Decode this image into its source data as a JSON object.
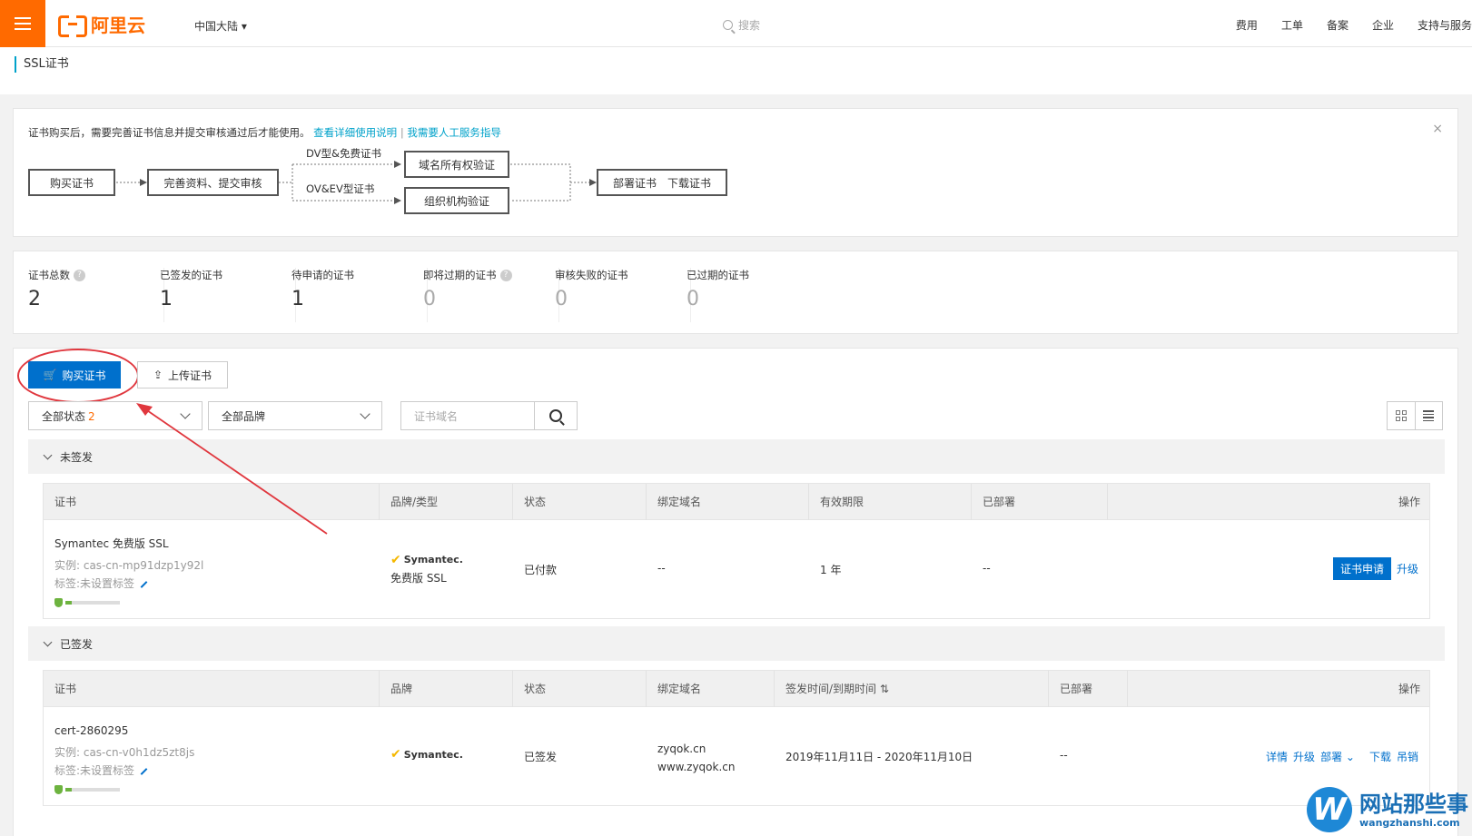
{
  "topbar": {
    "logo_text": "阿里云",
    "region": "中国大陆 ▾",
    "search_placeholder": "搜索",
    "links": [
      "费用",
      "工单",
      "备案",
      "企业",
      "支持与服务"
    ]
  },
  "breadcrumb": "SSL证书",
  "tip": {
    "text": "证书购买后，需要完善证书信息并提交审核通过后才能使用。",
    "link1": "查看详细使用说明",
    "separator": "|",
    "link2": "我需要人工服务指导",
    "close": "×"
  },
  "flow": {
    "buy": "购买证书",
    "complete": "完善资料、提交审核",
    "dv_label": "DV型&免费证书",
    "ov_label": "OV&EV型证书",
    "domain_verify": "域名所有权验证",
    "org_verify": "组织机构验证",
    "deploy": "部署证书　下载证书"
  },
  "stats": [
    {
      "label": "证书总数",
      "value": "2",
      "help": true
    },
    {
      "label": "已签发的证书",
      "value": "1",
      "help": false
    },
    {
      "label": "待申请的证书",
      "value": "1",
      "help": false
    },
    {
      "label": "即将过期的证书",
      "value": "0",
      "help": true
    },
    {
      "label": "审核失败的证书",
      "value": "0",
      "help": false
    },
    {
      "label": "已过期的证书",
      "value": "0",
      "help": false
    }
  ],
  "toolbar": {
    "buy_label": "购买证书",
    "upload_label": "上传证书",
    "status_filter": "全部状态",
    "status_count": "2",
    "brand_filter": "全部品牌",
    "domain_placeholder": "证书域名"
  },
  "unsigned": {
    "group_label": "未签发",
    "headers": [
      "证书",
      "品牌/类型",
      "状态",
      "绑定域名",
      "有效期限",
      "已部署",
      "操作"
    ],
    "row": {
      "name": "Symantec 免费版 SSL",
      "instance": "实例: cas-cn-mp91dzp1y92l",
      "tag": "标签:未设置标签",
      "brand": "Symantec.",
      "type": "免费版 SSL",
      "status": "已付款",
      "domain": "--",
      "validity": "1 年",
      "deployed": "--",
      "apply": "证书申请",
      "upgrade": "升级"
    }
  },
  "signed": {
    "group_label": "已签发",
    "headers": [
      "证书",
      "品牌",
      "状态",
      "绑定域名",
      "签发时间/到期时间",
      "已部署",
      "操作"
    ],
    "row": {
      "name": "cert-2860295",
      "instance": "实例: cas-cn-v0h1dz5zt8js",
      "tag": "标签:未设置标签",
      "brand": "Symantec.",
      "status": "已签发",
      "domain1": "zyqok.cn",
      "domain2": "www.zyqok.cn",
      "dates": "2019年11月11日 - 2020年11月10日",
      "deployed": "--",
      "actions": [
        "详情",
        "升级",
        "部署",
        "下载",
        "吊销"
      ]
    }
  },
  "watermark": {
    "letter": "W",
    "title": "网站那些事",
    "subtitle": "wangzhanshi.com"
  },
  "colors": {
    "brand_orange": "#ff6a00",
    "primary_blue": "#0070cc",
    "link_blue": "#00a2ca",
    "annotation_red": "#e0373e"
  }
}
